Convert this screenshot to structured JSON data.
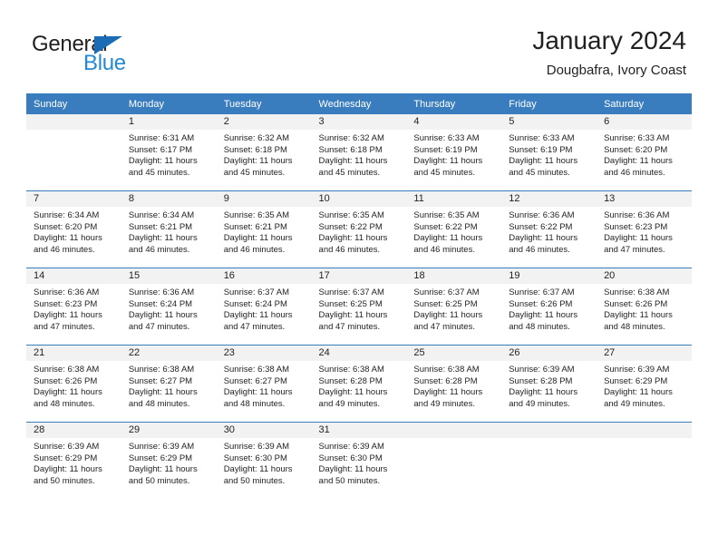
{
  "brand": {
    "name_part1": "General",
    "name_part2": "Blue",
    "accent_color": "#2389d4",
    "triangle_color": "#1c6cb5"
  },
  "header": {
    "title": "January 2024",
    "subtitle": "Dougbafra, Ivory Coast"
  },
  "theme": {
    "header_row_bg": "#3a7dbf",
    "day_band_bg": "#f2f2f2",
    "text_color": "#231f20"
  },
  "weekday_headers": [
    "Sunday",
    "Monday",
    "Tuesday",
    "Wednesday",
    "Thursday",
    "Friday",
    "Saturday"
  ],
  "weeks": [
    [
      {
        "day": "",
        "empty": true,
        "sunrise": "",
        "sunset": "",
        "daylight_line1": "",
        "daylight_line2": ""
      },
      {
        "day": "1",
        "sunrise": "Sunrise: 6:31 AM",
        "sunset": "Sunset: 6:17 PM",
        "daylight_line1": "Daylight: 11 hours",
        "daylight_line2": "and 45 minutes."
      },
      {
        "day": "2",
        "sunrise": "Sunrise: 6:32 AM",
        "sunset": "Sunset: 6:18 PM",
        "daylight_line1": "Daylight: 11 hours",
        "daylight_line2": "and 45 minutes."
      },
      {
        "day": "3",
        "sunrise": "Sunrise: 6:32 AM",
        "sunset": "Sunset: 6:18 PM",
        "daylight_line1": "Daylight: 11 hours",
        "daylight_line2": "and 45 minutes."
      },
      {
        "day": "4",
        "sunrise": "Sunrise: 6:33 AM",
        "sunset": "Sunset: 6:19 PM",
        "daylight_line1": "Daylight: 11 hours",
        "daylight_line2": "and 45 minutes."
      },
      {
        "day": "5",
        "sunrise": "Sunrise: 6:33 AM",
        "sunset": "Sunset: 6:19 PM",
        "daylight_line1": "Daylight: 11 hours",
        "daylight_line2": "and 45 minutes."
      },
      {
        "day": "6",
        "sunrise": "Sunrise: 6:33 AM",
        "sunset": "Sunset: 6:20 PM",
        "daylight_line1": "Daylight: 11 hours",
        "daylight_line2": "and 46 minutes."
      }
    ],
    [
      {
        "day": "7",
        "sunrise": "Sunrise: 6:34 AM",
        "sunset": "Sunset: 6:20 PM",
        "daylight_line1": "Daylight: 11 hours",
        "daylight_line2": "and 46 minutes."
      },
      {
        "day": "8",
        "sunrise": "Sunrise: 6:34 AM",
        "sunset": "Sunset: 6:21 PM",
        "daylight_line1": "Daylight: 11 hours",
        "daylight_line2": "and 46 minutes."
      },
      {
        "day": "9",
        "sunrise": "Sunrise: 6:35 AM",
        "sunset": "Sunset: 6:21 PM",
        "daylight_line1": "Daylight: 11 hours",
        "daylight_line2": "and 46 minutes."
      },
      {
        "day": "10",
        "sunrise": "Sunrise: 6:35 AM",
        "sunset": "Sunset: 6:22 PM",
        "daylight_line1": "Daylight: 11 hours",
        "daylight_line2": "and 46 minutes."
      },
      {
        "day": "11",
        "sunrise": "Sunrise: 6:35 AM",
        "sunset": "Sunset: 6:22 PM",
        "daylight_line1": "Daylight: 11 hours",
        "daylight_line2": "and 46 minutes."
      },
      {
        "day": "12",
        "sunrise": "Sunrise: 6:36 AM",
        "sunset": "Sunset: 6:22 PM",
        "daylight_line1": "Daylight: 11 hours",
        "daylight_line2": "and 46 minutes."
      },
      {
        "day": "13",
        "sunrise": "Sunrise: 6:36 AM",
        "sunset": "Sunset: 6:23 PM",
        "daylight_line1": "Daylight: 11 hours",
        "daylight_line2": "and 47 minutes."
      }
    ],
    [
      {
        "day": "14",
        "sunrise": "Sunrise: 6:36 AM",
        "sunset": "Sunset: 6:23 PM",
        "daylight_line1": "Daylight: 11 hours",
        "daylight_line2": "and 47 minutes."
      },
      {
        "day": "15",
        "sunrise": "Sunrise: 6:36 AM",
        "sunset": "Sunset: 6:24 PM",
        "daylight_line1": "Daylight: 11 hours",
        "daylight_line2": "and 47 minutes."
      },
      {
        "day": "16",
        "sunrise": "Sunrise: 6:37 AM",
        "sunset": "Sunset: 6:24 PM",
        "daylight_line1": "Daylight: 11 hours",
        "daylight_line2": "and 47 minutes."
      },
      {
        "day": "17",
        "sunrise": "Sunrise: 6:37 AM",
        "sunset": "Sunset: 6:25 PM",
        "daylight_line1": "Daylight: 11 hours",
        "daylight_line2": "and 47 minutes."
      },
      {
        "day": "18",
        "sunrise": "Sunrise: 6:37 AM",
        "sunset": "Sunset: 6:25 PM",
        "daylight_line1": "Daylight: 11 hours",
        "daylight_line2": "and 47 minutes."
      },
      {
        "day": "19",
        "sunrise": "Sunrise: 6:37 AM",
        "sunset": "Sunset: 6:26 PM",
        "daylight_line1": "Daylight: 11 hours",
        "daylight_line2": "and 48 minutes."
      },
      {
        "day": "20",
        "sunrise": "Sunrise: 6:38 AM",
        "sunset": "Sunset: 6:26 PM",
        "daylight_line1": "Daylight: 11 hours",
        "daylight_line2": "and 48 minutes."
      }
    ],
    [
      {
        "day": "21",
        "sunrise": "Sunrise: 6:38 AM",
        "sunset": "Sunset: 6:26 PM",
        "daylight_line1": "Daylight: 11 hours",
        "daylight_line2": "and 48 minutes."
      },
      {
        "day": "22",
        "sunrise": "Sunrise: 6:38 AM",
        "sunset": "Sunset: 6:27 PM",
        "daylight_line1": "Daylight: 11 hours",
        "daylight_line2": "and 48 minutes."
      },
      {
        "day": "23",
        "sunrise": "Sunrise: 6:38 AM",
        "sunset": "Sunset: 6:27 PM",
        "daylight_line1": "Daylight: 11 hours",
        "daylight_line2": "and 48 minutes."
      },
      {
        "day": "24",
        "sunrise": "Sunrise: 6:38 AM",
        "sunset": "Sunset: 6:28 PM",
        "daylight_line1": "Daylight: 11 hours",
        "daylight_line2": "and 49 minutes."
      },
      {
        "day": "25",
        "sunrise": "Sunrise: 6:38 AM",
        "sunset": "Sunset: 6:28 PM",
        "daylight_line1": "Daylight: 11 hours",
        "daylight_line2": "and 49 minutes."
      },
      {
        "day": "26",
        "sunrise": "Sunrise: 6:39 AM",
        "sunset": "Sunset: 6:28 PM",
        "daylight_line1": "Daylight: 11 hours",
        "daylight_line2": "and 49 minutes."
      },
      {
        "day": "27",
        "sunrise": "Sunrise: 6:39 AM",
        "sunset": "Sunset: 6:29 PM",
        "daylight_line1": "Daylight: 11 hours",
        "daylight_line2": "and 49 minutes."
      }
    ],
    [
      {
        "day": "28",
        "sunrise": "Sunrise: 6:39 AM",
        "sunset": "Sunset: 6:29 PM",
        "daylight_line1": "Daylight: 11 hours",
        "daylight_line2": "and 50 minutes."
      },
      {
        "day": "29",
        "sunrise": "Sunrise: 6:39 AM",
        "sunset": "Sunset: 6:29 PM",
        "daylight_line1": "Daylight: 11 hours",
        "daylight_line2": "and 50 minutes."
      },
      {
        "day": "30",
        "sunrise": "Sunrise: 6:39 AM",
        "sunset": "Sunset: 6:30 PM",
        "daylight_line1": "Daylight: 11 hours",
        "daylight_line2": "and 50 minutes."
      },
      {
        "day": "31",
        "sunrise": "Sunrise: 6:39 AM",
        "sunset": "Sunset: 6:30 PM",
        "daylight_line1": "Daylight: 11 hours",
        "daylight_line2": "and 50 minutes."
      },
      {
        "day": "",
        "empty": true,
        "sunrise": "",
        "sunset": "",
        "daylight_line1": "",
        "daylight_line2": ""
      },
      {
        "day": "",
        "empty": true,
        "sunrise": "",
        "sunset": "",
        "daylight_line1": "",
        "daylight_line2": ""
      },
      {
        "day": "",
        "empty": true,
        "sunrise": "",
        "sunset": "",
        "daylight_line1": "",
        "daylight_line2": ""
      }
    ]
  ]
}
